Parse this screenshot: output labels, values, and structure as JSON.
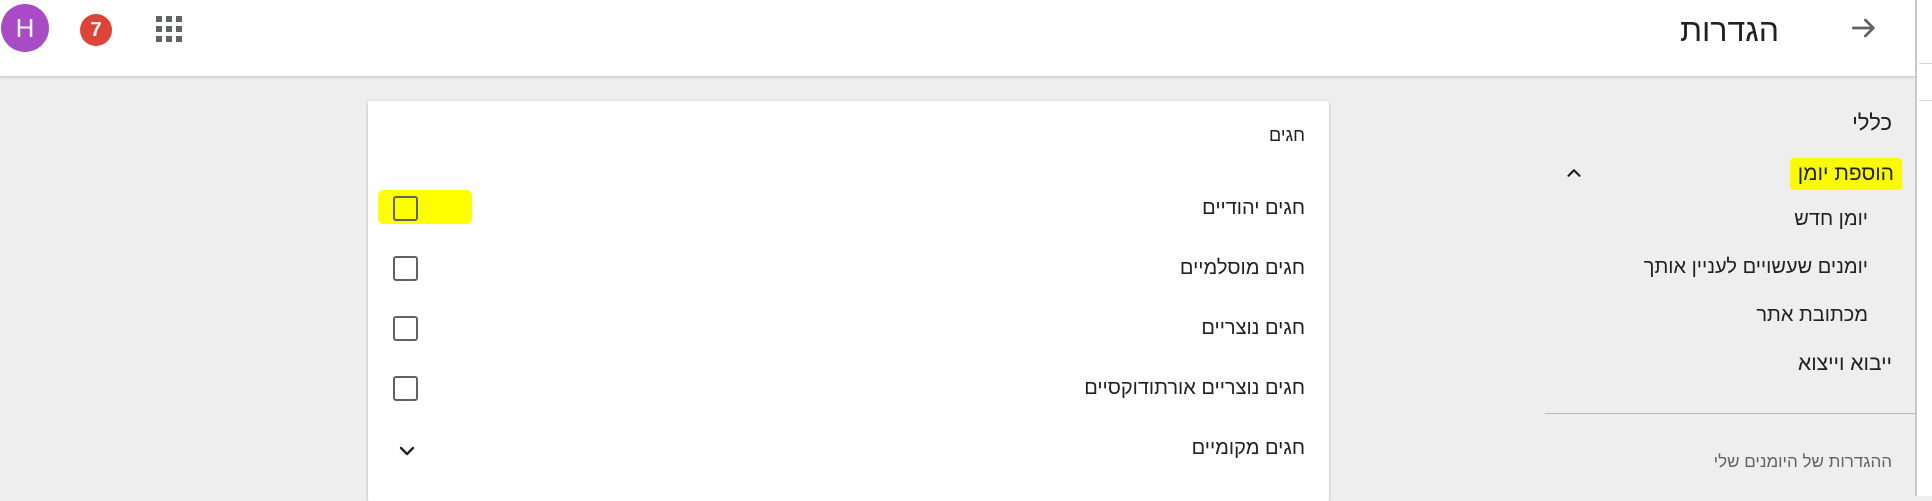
{
  "header": {
    "title": "הגדרות",
    "avatar_letter": "H",
    "notification_count": "7",
    "avatar_color": "#a84bc5",
    "badge_color": "#db4437",
    "apps_icon": "apps-grid-icon",
    "back_icon": "arrow-back-icon"
  },
  "sidebar": {
    "general": "כללי",
    "add_calendar": "הוספת יומן",
    "add_calendar_icon": "chevron-up-icon",
    "items": [
      "יומן חדש",
      "יומנים שעשויים לעניין אותך",
      "מכתובת אתר"
    ],
    "import_export": "ייבוא וייצוא",
    "section_caption": "ההגדרות של היומנים שלי",
    "highlight_color": "#fbfb00"
  },
  "card": {
    "title": "חגים",
    "options": [
      {
        "label": "חגים יהודיים",
        "checked": false
      },
      {
        "label": "חגים מוסלמיים",
        "checked": false
      },
      {
        "label": "חגים נוצריים",
        "checked": false
      },
      {
        "label": "חגים נוצריים אורתודוקסיים",
        "checked": false
      }
    ],
    "regional": {
      "label": "חגים מקומיים",
      "icon": "chevron-down-icon"
    }
  }
}
